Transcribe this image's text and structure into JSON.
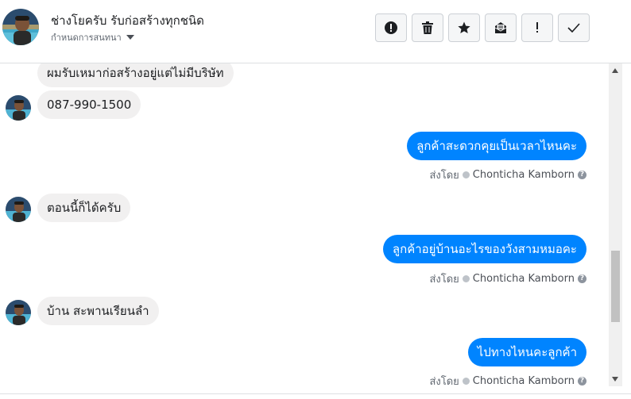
{
  "header": {
    "title": "ช่างโยครับ รับก่อสร้างทุกชนิด",
    "subtitle": "กำหนดการสนทนา",
    "toolbar": [
      {
        "name": "report-icon",
        "label": "Report"
      },
      {
        "name": "trash-icon",
        "label": "Delete"
      },
      {
        "name": "star-icon",
        "label": "Star"
      },
      {
        "name": "mark-unread-icon",
        "label": "Mark unread"
      },
      {
        "name": "alert-icon",
        "label": "Spam"
      },
      {
        "name": "checkmark-icon",
        "label": "Done"
      }
    ]
  },
  "messages": [
    {
      "side": "in",
      "text": "ผมรับเหมาก่อสร้างอยู่แต่ไม่มีบริษัท"
    },
    {
      "side": "in",
      "text": "087-990-1500"
    },
    {
      "side": "out",
      "text": "ลูกค้าสะดวกคุยเป็นเวลาไหนคะ",
      "sent_by_label": "ส่งโดย",
      "sender": "Chonticha Kamborn"
    },
    {
      "side": "in",
      "text": "ตอนนี้ก็ได้ครับ"
    },
    {
      "side": "out",
      "text": "ลูกค้าอยู่บ้านอะไรของวังสามหมอคะ",
      "sent_by_label": "ส่งโดย",
      "sender": "Chonticha Kamborn"
    },
    {
      "side": "in",
      "text": "บ้าน สะพานเรียนลำ"
    },
    {
      "side": "out",
      "text": "ไปทางไหนคะลูกค้า",
      "sent_by_label": "ส่งโดย",
      "sender": "Chonticha Kamborn"
    }
  ],
  "colors": {
    "outgoing": "#0084ff",
    "incoming": "#f1f0f0"
  }
}
